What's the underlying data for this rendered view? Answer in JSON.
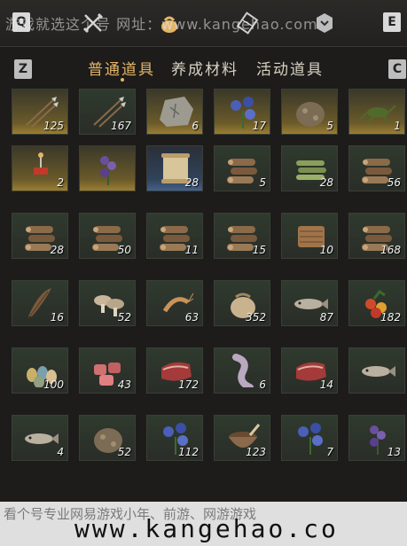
{
  "watermark_top": "游戏就选这个号  网址：www.kangehao.com",
  "keys": {
    "q": "Q",
    "e": "E",
    "z": "Z",
    "c": "C"
  },
  "top_icons": [
    "crossed-swords-icon",
    "pouch-icon",
    "scroll-icon",
    "badge-icon"
  ],
  "tabs": [
    {
      "label": "普通道具",
      "active": true
    },
    {
      "label": "养成材料",
      "active": false
    },
    {
      "label": "活动道具",
      "active": false
    }
  ],
  "colors": {
    "accent": "#e3b56a",
    "slot": "#2f3a2e",
    "gold": "#9a7e32",
    "blue": "#45618a"
  },
  "items": [
    {
      "name": "arrows",
      "qty": "125",
      "rarity": "gold",
      "icon": "arrows-icon"
    },
    {
      "name": "arrows-2",
      "qty": "167",
      "rarity": "normal",
      "icon": "arrows-icon"
    },
    {
      "name": "stone-tablet",
      "qty": "6",
      "rarity": "gold",
      "icon": "stone-icon"
    },
    {
      "name": "blue-flower",
      "qty": "17",
      "rarity": "gold",
      "icon": "flower-icon"
    },
    {
      "name": "ore",
      "qty": "5",
      "rarity": "gold",
      "icon": "ore-icon"
    },
    {
      "name": "cricket",
      "qty": "1",
      "rarity": "gold",
      "icon": "cricket-icon"
    },
    {
      "name": "firecracker",
      "qty": "2",
      "rarity": "gold",
      "icon": "firecracker-icon"
    },
    {
      "name": "purple-herb",
      "qty": "",
      "rarity": "gold",
      "icon": "herb-icon"
    },
    {
      "name": "scroll",
      "qty": "28",
      "rarity": "blue",
      "icon": "scroll-item-icon"
    },
    {
      "name": "logs",
      "qty": "5",
      "rarity": "normal",
      "icon": "logs-icon"
    },
    {
      "name": "bamboo",
      "qty": "28",
      "rarity": "normal",
      "icon": "bamboo-icon"
    },
    {
      "name": "logs-2",
      "qty": "56",
      "rarity": "normal",
      "icon": "logs-icon"
    },
    {
      "name": "logs-3",
      "qty": "28",
      "rarity": "normal",
      "icon": "logs-icon"
    },
    {
      "name": "logs-4",
      "qty": "50",
      "rarity": "normal",
      "icon": "logs-icon"
    },
    {
      "name": "logs-5",
      "qty": "11",
      "rarity": "normal",
      "icon": "logs-icon"
    },
    {
      "name": "logs-6",
      "qty": "15",
      "rarity": "normal",
      "icon": "logs-icon"
    },
    {
      "name": "hay",
      "qty": "10",
      "rarity": "normal",
      "icon": "hay-icon"
    },
    {
      "name": "logs-7",
      "qty": "168",
      "rarity": "normal",
      "icon": "logs-icon"
    },
    {
      "name": "feather",
      "qty": "16",
      "rarity": "normal",
      "icon": "feather-icon"
    },
    {
      "name": "mushroom",
      "qty": "52",
      "rarity": "normal",
      "icon": "mushroom-icon"
    },
    {
      "name": "shrimp",
      "qty": "63",
      "rarity": "normal",
      "icon": "shrimp-icon"
    },
    {
      "name": "grain-sack",
      "qty": "352",
      "rarity": "normal",
      "icon": "sack-icon"
    },
    {
      "name": "fish",
      "qty": "87",
      "rarity": "normal",
      "icon": "fish-icon"
    },
    {
      "name": "berries",
      "qty": "182",
      "rarity": "normal",
      "icon": "berries-icon"
    },
    {
      "name": "eggs",
      "qty": "100",
      "rarity": "normal",
      "icon": "eggs-icon"
    },
    {
      "name": "meat-chunks",
      "qty": "43",
      "rarity": "normal",
      "icon": "meat-icon"
    },
    {
      "name": "steak",
      "qty": "172",
      "rarity": "normal",
      "icon": "steak-icon"
    },
    {
      "name": "hide",
      "qty": "6",
      "rarity": "normal",
      "icon": "hide-icon"
    },
    {
      "name": "steak-2",
      "qty": "14",
      "rarity": "normal",
      "icon": "steak-icon"
    },
    {
      "name": "salmon",
      "qty": "",
      "rarity": "normal",
      "icon": "fish-icon"
    },
    {
      "name": "carp",
      "qty": "4",
      "rarity": "normal",
      "icon": "fish-icon"
    },
    {
      "name": "ore-pile",
      "qty": "52",
      "rarity": "normal",
      "icon": "ore-icon"
    },
    {
      "name": "white-flower",
      "qty": "112",
      "rarity": "normal",
      "icon": "flower-icon"
    },
    {
      "name": "mortar",
      "qty": "123",
      "rarity": "normal",
      "icon": "mortar-icon"
    },
    {
      "name": "purple-flower",
      "qty": "7",
      "rarity": "normal",
      "icon": "flower-icon"
    },
    {
      "name": "lavender",
      "qty": "13",
      "rarity": "normal",
      "icon": "herb-icon"
    }
  ],
  "watermark_bottom_cn": "看个号专业网易游戏小年、前游、网游游戏",
  "watermark_bottom_url": "www.kangehao.co"
}
